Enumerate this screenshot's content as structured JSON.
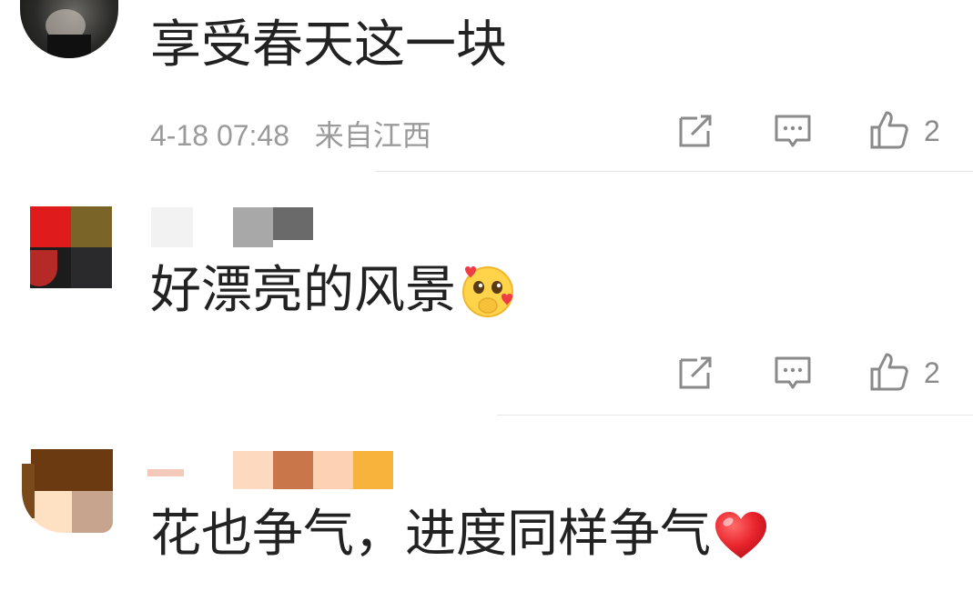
{
  "comments": [
    {
      "text": "享受春天这一块",
      "time": "4-18 07:48",
      "location": "来自江西",
      "like_count": "2"
    },
    {
      "text": "好漂亮的风景",
      "emoji": "pleading-face-hearts-icon",
      "like_count": "2"
    },
    {
      "text": "花也争气，进度同样争气",
      "emoji": "red-heart-icon"
    }
  ],
  "colors": {
    "meta_gray": "#9a9a9a",
    "icon_gray": "#8a8a8a",
    "divider": "#e6e6e6"
  }
}
